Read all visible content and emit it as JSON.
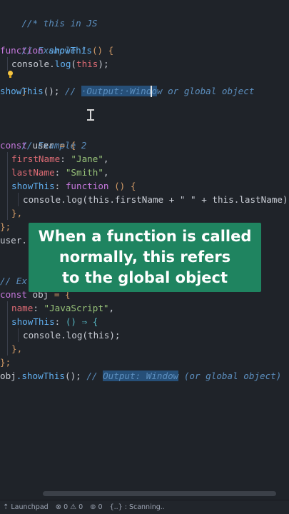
{
  "code": {
    "header_comment": "//* this in JS",
    "ex1_comment": "// Example 1",
    "ex1_kw_function": "function",
    "ex1_fn_name": "showThis",
    "ex1_parens_brace": "() {",
    "ex1_console": "console",
    "ex1_dot": ".",
    "ex1_log": "log",
    "ex1_this": "this",
    "ex1_close": "}",
    "ex1_call": "showThis",
    "ex1_call_tail": "();",
    "ex1_call_comment_lead": "// ",
    "ex1_call_comment_sel": "·Output:·Windo",
    "ex1_call_comment_rest": "w or global object",
    "ex2_comment": "// Example 2",
    "ex2_kw_const": "const",
    "ex2_user": "user",
    "ex2_eq_brace": " = {",
    "ex2_firstName_key": "firstName",
    "ex2_firstName_val": "\"Jane\"",
    "ex2_lastName_key": "lastName",
    "ex2_lastName_val": "\"Smith\"",
    "ex2_showThis_key": "showThis",
    "ex2_showThis_kw": "function",
    "ex2_showThis_tail": " () {",
    "ex2_console_line": "console.log(this.firstName + \" \" + this.lastName)",
    "ex2_inner_close": "},",
    "ex2_obj_close": "};",
    "ex2_user_call": "user.",
    "ex3_comment_visible": "// Ex",
    "ex3_kw_const": "const",
    "ex3_obj": "obj",
    "ex3_eq_brace": " = {",
    "ex3_name_key": "name",
    "ex3_name_val": "\"JavaScript\"",
    "ex3_showThis_key": "showThis",
    "ex3_arrow": "() ⇒ {",
    "ex3_console_line": "console.log(this);",
    "ex3_inner_close": "},",
    "ex3_obj_close": "};",
    "ex3_call_obj": "obj",
    "ex3_call_method": ".showThis",
    "ex3_call_tail": "(); ",
    "ex3_comment_lead": "// ",
    "ex3_comment_sel": "Output: Window",
    "ex3_comment_rest": " (or global object)"
  },
  "overlay": {
    "line1": "When a function is called",
    "line2": "normally, this refers",
    "line3": "to the global object",
    "background": "#1f8460"
  },
  "statusbar": {
    "launchpad_icon": "launchpad-icon",
    "launchpad_label": "Launchpad",
    "errors_icon": "error-circle-icon",
    "errors_count": "0",
    "warnings_icon": "warning-triangle-icon",
    "warnings_count": "0",
    "ports_icon": "broadcast-icon",
    "ports_count": "0",
    "scanning_label": "{..} : Scanning.."
  },
  "colors": {
    "editor_bg": "#1f2329",
    "keyword": "#c678dd",
    "function": "#61afef",
    "property": "#e06c75",
    "string": "#98c379",
    "comment": "#5c8fbf",
    "selection": "#264f78"
  }
}
